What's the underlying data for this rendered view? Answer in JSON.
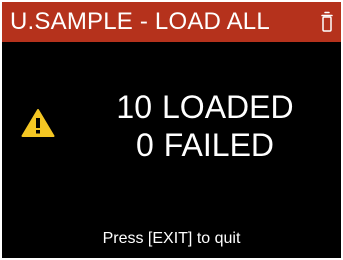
{
  "header": {
    "title": "U.SAMPLE - LOAD ALL",
    "icon": "trash-icon",
    "background_color": "#b5321c"
  },
  "status": {
    "icon": "warning-icon",
    "icon_color": "#f4c623",
    "loaded_count": "10",
    "loaded_label": "LOADED",
    "failed_count": "0",
    "failed_label": "FAILED"
  },
  "footer": {
    "hint": "Press [EXIT] to quit"
  }
}
